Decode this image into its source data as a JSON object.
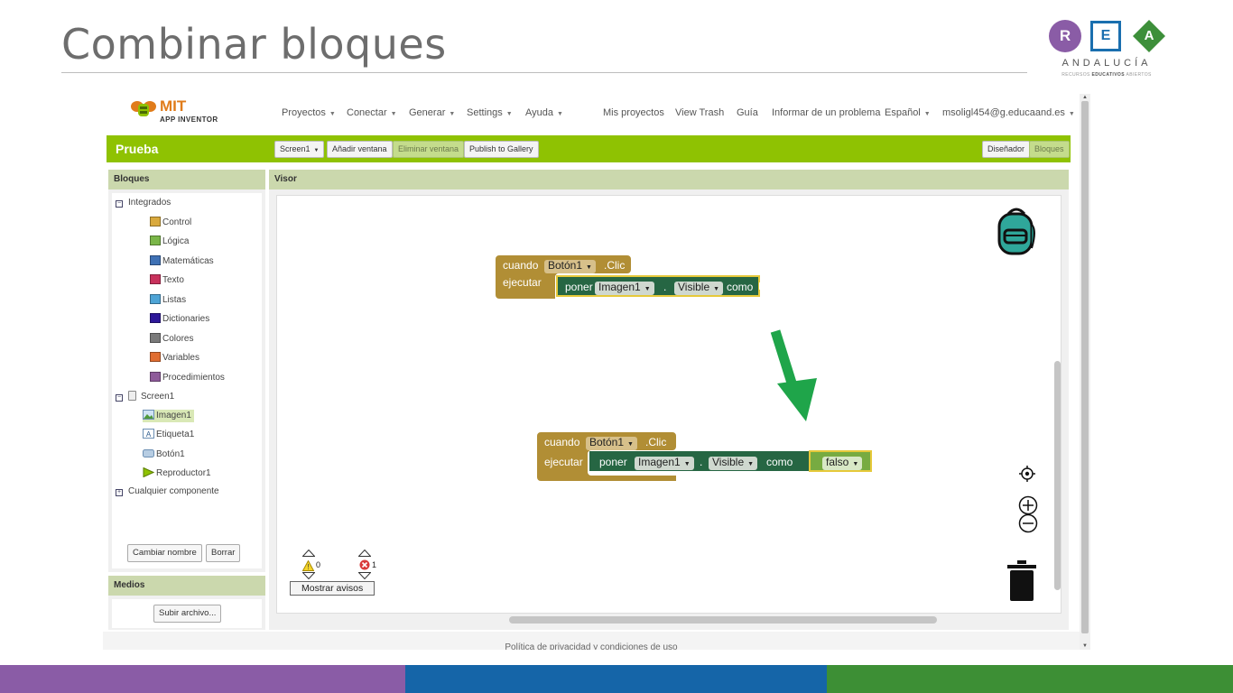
{
  "slide": {
    "title": "Combinar bloques",
    "logo": {
      "r": "R",
      "e": "E",
      "a": "A",
      "name": "ANDALUCÍA",
      "sub_1": "RECURSOS",
      "sub_2": "EDUCATIVOS",
      "sub_3": "ABIERTOS",
      "colors": {
        "r": "#8a5ca6",
        "e": "#1a6faf",
        "a": "#3d8f3a"
      }
    },
    "bottom_bar_colors": [
      "#8a5ca6",
      "#1565a8",
      "#3d8f35"
    ]
  },
  "app": {
    "logo": {
      "mit": "MIT",
      "name": "APP INVENTOR"
    },
    "menus": {
      "proyectos": "Proyectos",
      "conectar": "Conectar",
      "generar": "Generar",
      "settings": "Settings",
      "ayuda": "Ayuda",
      "mis_proyectos": "Mis proyectos",
      "view_trash": "View Trash",
      "guia": "Guía",
      "informar": "Informar de un problema",
      "idioma": "Español",
      "user": "msoligl454@g.educaand.es"
    },
    "project_bar": {
      "name": "Prueba",
      "screen_select": "Screen1",
      "add_screen": "Añadir ventana",
      "remove_screen": "Eliminar ventana",
      "publish": "Publish to Gallery",
      "designer": "Diseñador",
      "blocks": "Bloques"
    },
    "bloques_panel": {
      "header": "Bloques",
      "integrados_label": "Integrados",
      "builtins": [
        {
          "label": "Control",
          "color": "#d9a93d"
        },
        {
          "label": "Lógica",
          "color": "#7ab648"
        },
        {
          "label": "Matemáticas",
          "color": "#3f71b5"
        },
        {
          "label": "Texto",
          "color": "#c8325c"
        },
        {
          "label": "Listas",
          "color": "#4ea4d6"
        },
        {
          "label": "Dictionaries",
          "color": "#2d1899"
        },
        {
          "label": "Colores",
          "color": "#7a7a7a"
        },
        {
          "label": "Variables",
          "color": "#e06d30"
        },
        {
          "label": "Procedimientos",
          "color": "#8e5a9a"
        }
      ],
      "screen_label": "Screen1",
      "components": [
        {
          "label": "Imagen1",
          "icon": "image-icon",
          "selected": true
        },
        {
          "label": "Etiqueta1",
          "icon": "label-icon",
          "selected": false
        },
        {
          "label": "Botón1",
          "icon": "button-icon",
          "selected": false
        },
        {
          "label": "Reproductor1",
          "icon": "player-icon",
          "selected": false
        }
      ],
      "any_component": "Cualquier componente",
      "rename_button": "Cambiar nombre",
      "delete_button": "Borrar"
    },
    "medios_panel": {
      "header": "Medios",
      "upload_button": "Subir archivo..."
    },
    "visor": {
      "header": "Visor",
      "block1": {
        "when": "cuando",
        "component": "Botón1",
        "event": ".Clic",
        "do": "ejecutar",
        "set": "poner",
        "target": "Imagen1",
        "dot": ".",
        "property": "Visible",
        "to": "como"
      },
      "block2": {
        "when": "cuando",
        "component": "Botón1",
        "event": ".Clic",
        "do": "ejecutar",
        "set": "poner",
        "target": "Imagen1",
        "dot": ".",
        "property": "Visible",
        "to": "como",
        "value": "falso"
      },
      "warnings_count": "0",
      "errors_count": "1",
      "show_warnings": "Mostrar avisos"
    },
    "footer": "Política de privacidad y condiciones de uso",
    "colors": {
      "green_bar": "#8fc202",
      "event_block": "#b18e35",
      "setter_block": "#266643",
      "logic_block": "#77ab41"
    }
  }
}
